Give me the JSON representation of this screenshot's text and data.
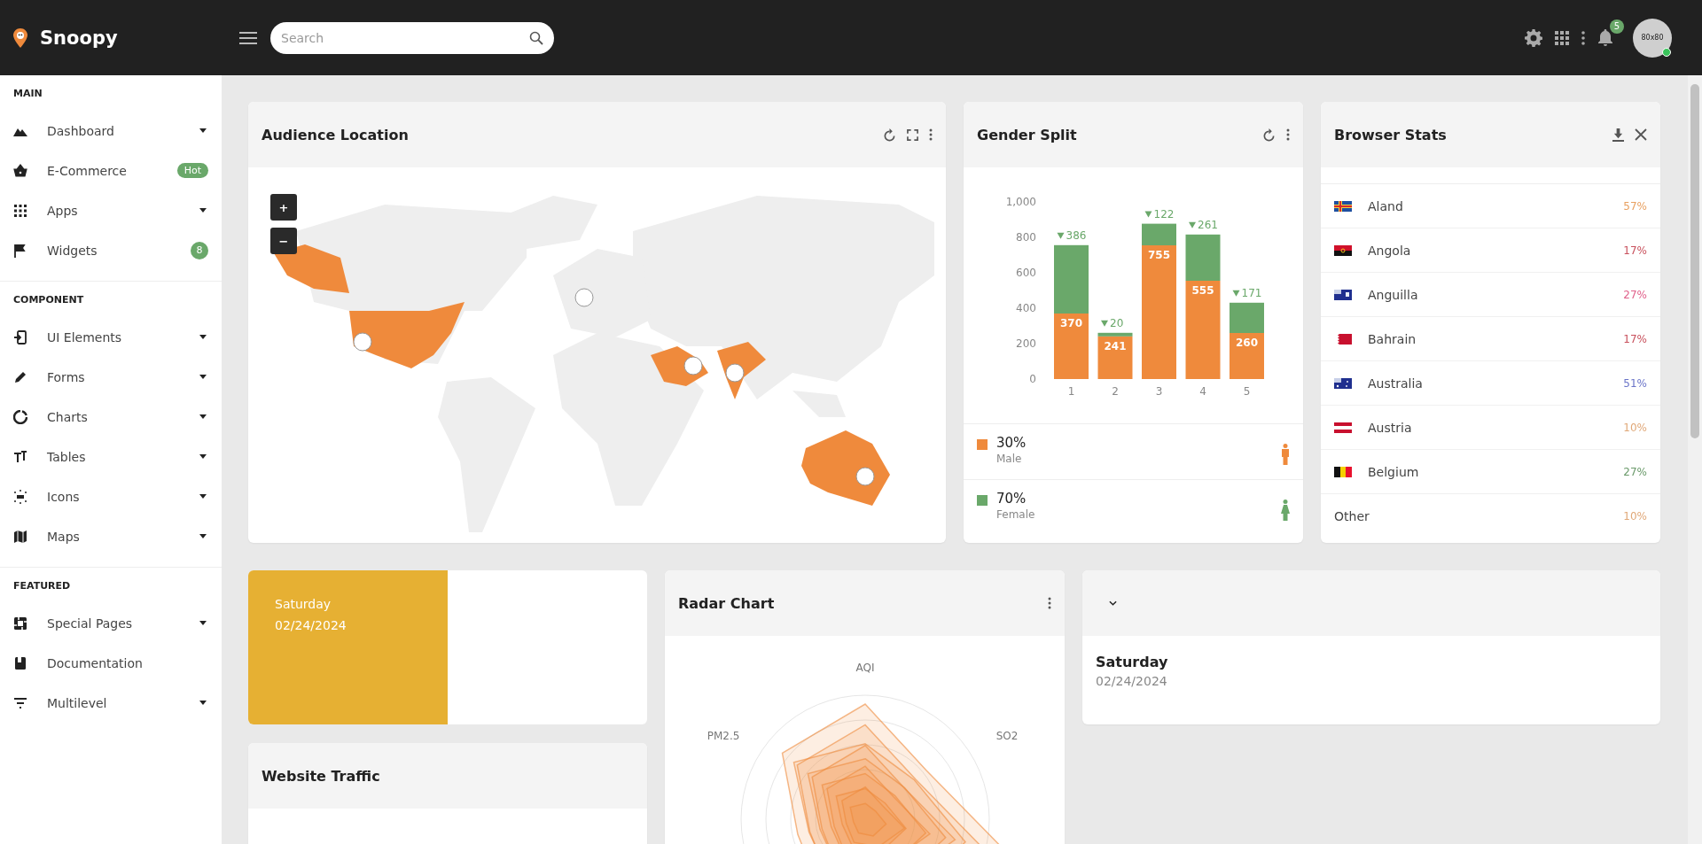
{
  "topbar": {
    "brand": "Snoopy",
    "search": {
      "placeholder": "Search"
    },
    "notifications": "5",
    "avatar": "80x80",
    "online": true
  },
  "sidebar": {
    "sections": [
      {
        "title": "MAIN",
        "items": [
          {
            "label": "Dashboard",
            "expandable": true
          },
          {
            "label": "E-Commerce",
            "expandable": false,
            "badge": "Hot"
          },
          {
            "label": "Apps",
            "expandable": true
          },
          {
            "label": "Widgets",
            "expandable": false,
            "badge": "8"
          }
        ]
      },
      {
        "title": "COMPONENT",
        "items": [
          {
            "label": "UI Elements",
            "expandable": true
          },
          {
            "label": "Forms",
            "expandable": true
          },
          {
            "label": "Charts",
            "expandable": true
          },
          {
            "label": "Tables",
            "expandable": true
          },
          {
            "label": "Icons",
            "expandable": true
          },
          {
            "label": "Maps",
            "expandable": true
          }
        ]
      },
      {
        "title": "FEATURED",
        "items": [
          {
            "label": "Special Pages",
            "expandable": true
          },
          {
            "label": "Documentation",
            "expandable": false
          },
          {
            "label": "Multilevel",
            "expandable": true
          }
        ]
      }
    ]
  },
  "audience_location": {
    "title": "Audience Location",
    "zoom_in": "+",
    "zoom_out": "−"
  },
  "gender_split": {
    "title": "Gender Split",
    "chart_data": {
      "type": "bar",
      "stacked": true,
      "categories": [
        "1",
        "2",
        "3",
        "4",
        "5"
      ],
      "series": [
        {
          "name": "Male",
          "color": "#ef8a3c",
          "values": [
            370,
            241,
            755,
            555,
            260
          ]
        },
        {
          "name": "Female",
          "color": "#6aa86a",
          "values": [
            386,
            20,
            122,
            261,
            171
          ]
        }
      ],
      "ylim": [
        0,
        1000
      ],
      "yticks": [
        0,
        200,
        400,
        600,
        800,
        {
          "value": 1000,
          "label": "1,000"
        }
      ],
      "data_labels": true
    },
    "legend": [
      {
        "value": "30%"
      },
      {
        "value": "70%"
      }
    ]
  },
  "browser_stats": {
    "title": "Browser Stats",
    "rows": [
      {
        "kind": "country",
        "name": "Aland",
        "value": "57%",
        "color": "#e8a060"
      },
      {
        "kind": "country",
        "name": "Angola",
        "value": "17%",
        "color": "#c8505c"
      },
      {
        "kind": "country",
        "name": "Anguilla",
        "value": "27%",
        "color": "#e0608a"
      },
      {
        "kind": "country",
        "name": "Bahrain",
        "value": "17%",
        "color": "#c8505c"
      },
      {
        "kind": "country",
        "name": "Australia",
        "value": "51%",
        "color": "#6a74c8"
      },
      {
        "kind": "country",
        "name": "Austria",
        "value": "10%",
        "color": "#e0a878"
      },
      {
        "kind": "country",
        "name": "Belgium",
        "value": "27%",
        "color": "#6a9a6a"
      },
      {
        "kind": "other",
        "name": "Other",
        "value": "10%",
        "color": "#e0a878"
      }
    ]
  },
  "date_card": {
    "day": "Saturday",
    "date": "02/24/2024"
  },
  "radar_chart": {
    "title": "Radar Chart",
    "axis_labels": [
      "AQI",
      "SO2",
      "PM2.5"
    ]
  },
  "date_widget": {
    "day": "Saturday",
    "date": "02/24/2024"
  },
  "website_traffic": {
    "title": "Website Traffic"
  }
}
